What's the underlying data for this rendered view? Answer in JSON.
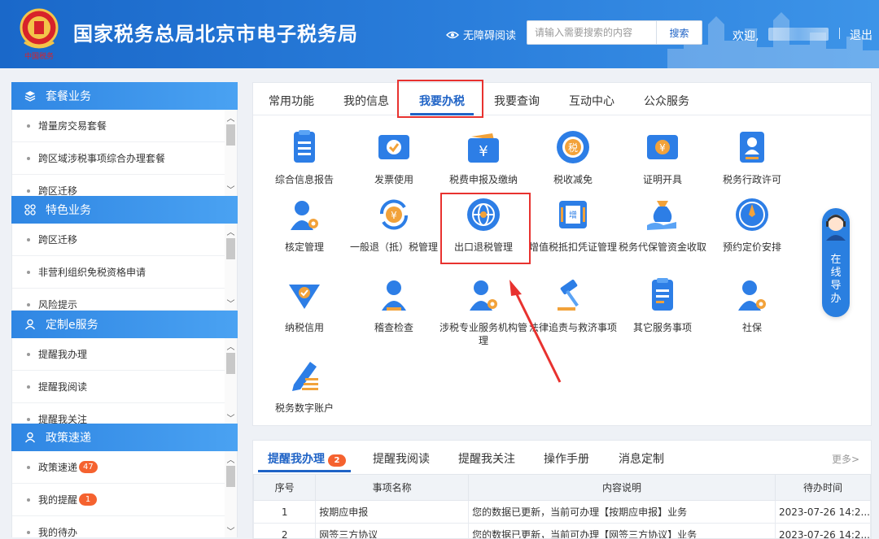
{
  "header": {
    "site_title": "国家税务总局北京市电子税务局",
    "accessibility": "无障碍阅读",
    "search_placeholder": "请输入需要搜索的内容",
    "search_button": "搜索",
    "welcome": "欢迎,",
    "logout": "退出"
  },
  "sidebar": {
    "sections": [
      {
        "title": "套餐业务",
        "icon": "layers-icon",
        "items": [
          {
            "label": "增量房交易套餐"
          },
          {
            "label": "跨区域涉税事项综合办理套餐"
          },
          {
            "label": "跨区迁移"
          }
        ]
      },
      {
        "title": "特色业务",
        "icon": "grid-icon",
        "items": [
          {
            "label": "跨区迁移"
          },
          {
            "label": "非营利组织免税资格申请"
          },
          {
            "label": "风险提示"
          }
        ]
      },
      {
        "title": "定制e服务",
        "icon": "user-icon",
        "items": [
          {
            "label": "提醒我办理"
          },
          {
            "label": "提醒我阅读"
          },
          {
            "label": "提醒我关注"
          }
        ]
      },
      {
        "title": "政策速递",
        "icon": "user-icon",
        "items": [
          {
            "label": "政策速递",
            "badge": "47"
          },
          {
            "label": "我的提醒",
            "badge": "1"
          },
          {
            "label": "我的待办"
          }
        ]
      }
    ]
  },
  "main": {
    "tabs": [
      "常用功能",
      "我的信息",
      "我要办税",
      "我要查询",
      "互动中心",
      "公众服务"
    ],
    "active_tab": "我要办税",
    "items": [
      {
        "label": "综合信息报告",
        "icon": "report-icon"
      },
      {
        "label": "发票使用",
        "icon": "invoice-icon"
      },
      {
        "label": "税费申报及缴纳",
        "icon": "wallet-icon"
      },
      {
        "label": "税收减免",
        "icon": "tax-relief-icon"
      },
      {
        "label": "证明开具",
        "icon": "certificate-icon"
      },
      {
        "label": "税务行政许可",
        "icon": "license-icon"
      },
      {
        "label": "核定管理",
        "icon": "user-gear-icon"
      },
      {
        "label": "一般退（抵）税管理",
        "icon": "refund-icon"
      },
      {
        "label": "出口退税管理",
        "icon": "globe-icon"
      },
      {
        "label": "增值税抵扣凭证管理",
        "icon": "voucher-icon"
      },
      {
        "label": "税务代保管资金收取",
        "icon": "money-bag-icon"
      },
      {
        "label": "预约定价安排",
        "icon": "compass-icon"
      },
      {
        "label": "纳税信用",
        "icon": "credit-icon"
      },
      {
        "label": "稽查检查",
        "icon": "inspector-icon"
      },
      {
        "label": "涉税专业服务机构管理",
        "icon": "agent-icon"
      },
      {
        "label": "法律追责与救济事项",
        "icon": "gavel-icon"
      },
      {
        "label": "其它服务事项",
        "icon": "list-icon"
      },
      {
        "label": "社保",
        "icon": "social-security-icon"
      },
      {
        "label": "税务数字账户",
        "icon": "pen-icon"
      }
    ]
  },
  "float_guide": {
    "text": "在线导办"
  },
  "todo": {
    "tabs": [
      {
        "label": "提醒我办理",
        "badge": "2"
      },
      {
        "label": "提醒我阅读"
      },
      {
        "label": "提醒我关注"
      },
      {
        "label": "操作手册"
      },
      {
        "label": "消息定制"
      }
    ],
    "more": "更多>",
    "columns": [
      "序号",
      "事项名称",
      "内容说明",
      "待办时间"
    ],
    "rows": [
      [
        "1",
        "按期应申报",
        "您的数据已更新，当前可办理【按期应申报】业务",
        "2023-07-26 14:2..."
      ],
      [
        "2",
        "网签三方协议",
        "您的数据已更新，当前可办理【网签三方协议】业务",
        "2023-07-26 14:2..."
      ]
    ]
  },
  "colors": {
    "primary": "#1f63c6",
    "header": "#2b7fdc",
    "highlight": "#e8322f",
    "badge": "#f5622f"
  }
}
